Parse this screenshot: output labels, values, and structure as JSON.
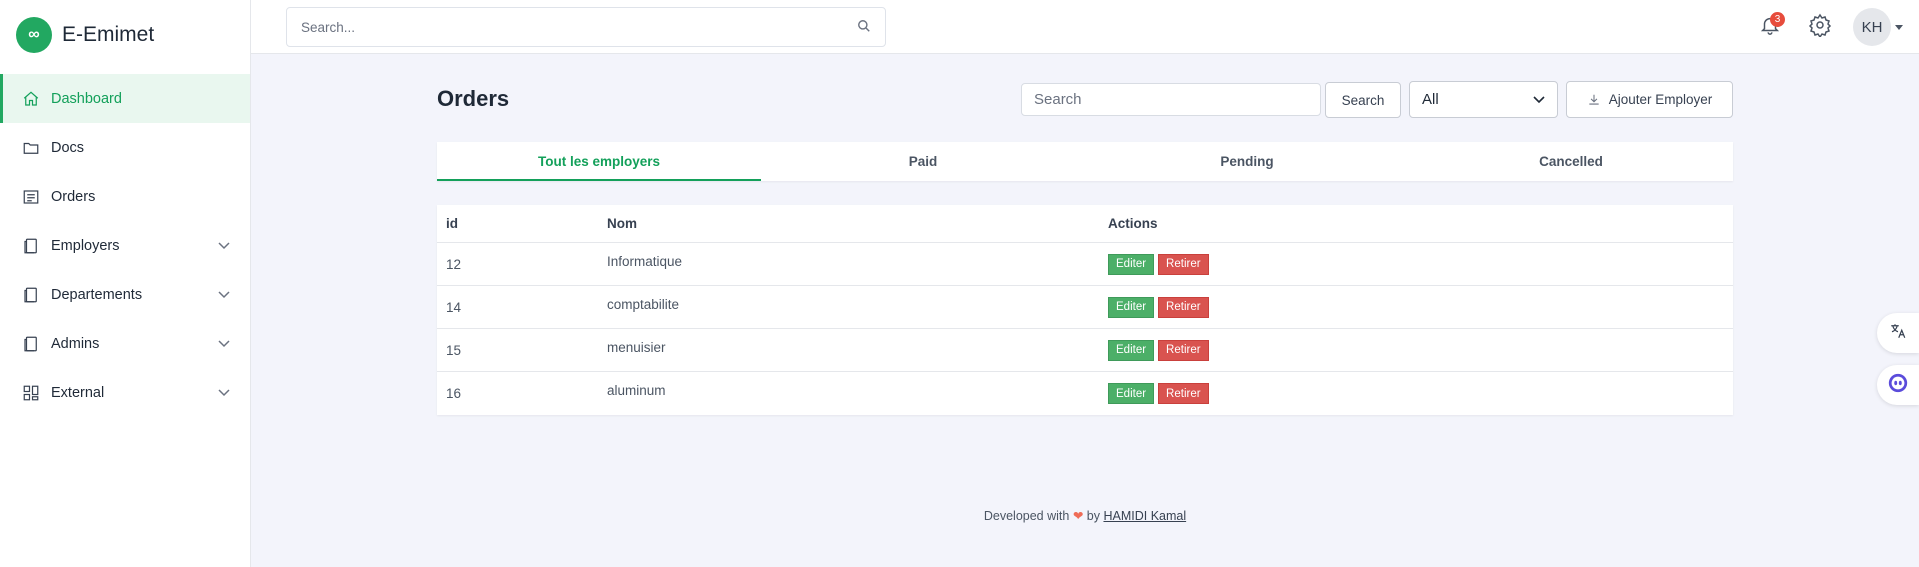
{
  "app": {
    "name": "E-Emimet",
    "logo_glyph": "∞"
  },
  "sidebar": {
    "items": [
      {
        "label": "Dashboard",
        "icon": "home-icon",
        "active": true,
        "expandable": false
      },
      {
        "label": "Docs",
        "icon": "folder-icon",
        "active": false,
        "expandable": false
      },
      {
        "label": "Orders",
        "icon": "list-icon",
        "active": false,
        "expandable": false
      },
      {
        "label": "Employers",
        "icon": "copy-icon",
        "active": false,
        "expandable": true
      },
      {
        "label": "Departements",
        "icon": "copy-icon",
        "active": false,
        "expandable": true
      },
      {
        "label": "Admins",
        "icon": "copy-icon",
        "active": false,
        "expandable": true
      },
      {
        "label": "External",
        "icon": "grid-icon",
        "active": false,
        "expandable": true
      }
    ]
  },
  "topbar": {
    "search_placeholder": "Search...",
    "notifications_count": "3",
    "avatar_initials": "KH"
  },
  "main": {
    "title": "Orders",
    "search_placeholder": "Search",
    "search_button": "Search",
    "filter_value": "All",
    "add_button": "Ajouter Employer",
    "tabs": [
      {
        "label": "Tout les employers",
        "active": true
      },
      {
        "label": "Paid",
        "active": false
      },
      {
        "label": "Pending",
        "active": false
      },
      {
        "label": "Cancelled",
        "active": false
      }
    ],
    "table": {
      "headers": {
        "id": "id",
        "nom": "Nom",
        "actions": "Actions"
      },
      "rows": [
        {
          "id": "12",
          "nom": "Informatique"
        },
        {
          "id": "14",
          "nom": "comptabilite"
        },
        {
          "id": "15",
          "nom": "menuisier"
        },
        {
          "id": "16",
          "nom": "aluminum"
        }
      ],
      "edit_label": "Editer",
      "remove_label": "Retirer"
    }
  },
  "footer": {
    "prefix": "Developed with",
    "by": "by",
    "author": "HAMIDI Kamal"
  },
  "colors": {
    "accent": "#22a861",
    "danger": "#d9534f",
    "background": "#f3f4fb"
  }
}
